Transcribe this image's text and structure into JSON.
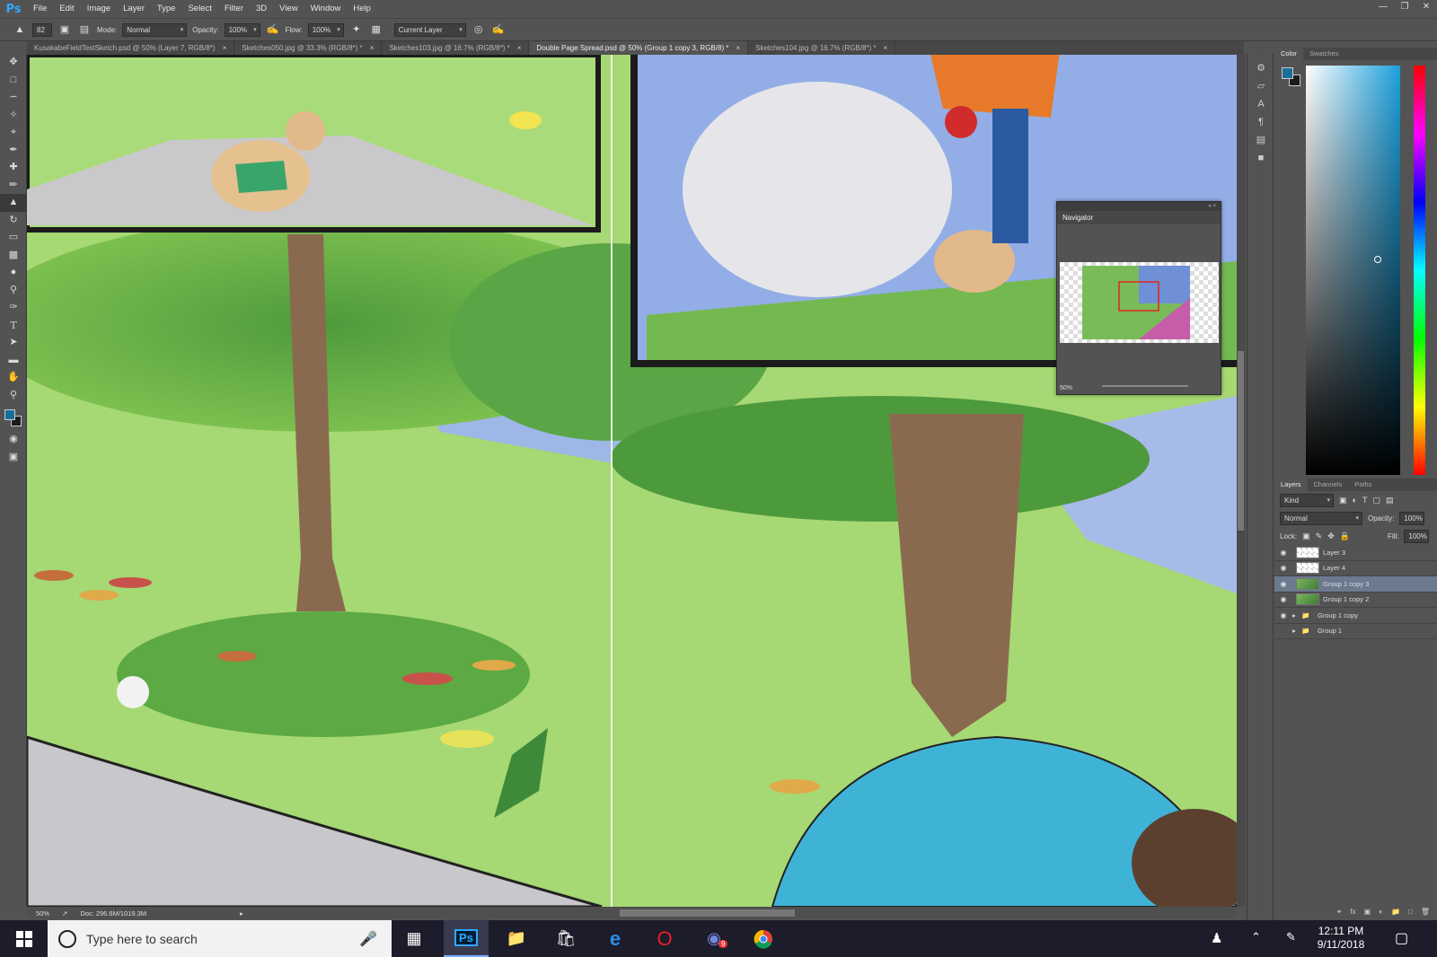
{
  "app": {
    "logo": "Ps"
  },
  "menu": [
    "File",
    "Edit",
    "Image",
    "Layer",
    "Type",
    "Select",
    "Filter",
    "3D",
    "View",
    "Window",
    "Help"
  ],
  "window_controls": [
    "minimize-icon",
    "restore-icon",
    "close-icon"
  ],
  "options": {
    "brush_size": "82",
    "mode_label": "Mode:",
    "mode": "Normal",
    "opacity_label": "Opacity:",
    "opacity": "100%",
    "flow_label": "Flow:",
    "flow": "100%",
    "sample": "Current Layer"
  },
  "tabs": [
    {
      "label": "KusakabeFieldTestSketch.psd @ 50% (Layer 7, RGB/8*)",
      "active": false
    },
    {
      "label": "Sketches050.jpg @ 33.3% (RGB/8*) *",
      "active": false
    },
    {
      "label": "Sketches103.jpg @ 16.7% (RGB/8*) *",
      "active": false
    },
    {
      "label": "Double Page Spread.psd @ 50% (Group 1 copy 3, RGB/8) *",
      "active": true
    },
    {
      "label": "Sketches104.jpg @ 16.7% (RGB/8*) *",
      "active": false
    }
  ],
  "tools": [
    "move-icon",
    "marquee-icon",
    "lasso-icon",
    "quick-select-icon",
    "crop-icon",
    "eyedropper-icon",
    "healing-icon",
    "brush-icon",
    "clone-stamp-icon",
    "history-brush-icon",
    "eraser-icon",
    "gradient-icon",
    "blur-icon",
    "dodge-icon",
    "pen-icon",
    "type-icon",
    "path-select-icon",
    "shape-icon",
    "hand-icon",
    "zoom-icon"
  ],
  "status": {
    "zoom": "50%",
    "doc": "Doc: 296.6M/1019.3M"
  },
  "navigator": {
    "title": "Navigator",
    "zoom": "50%"
  },
  "color_panel": {
    "tabs": [
      "Color",
      "Swatches"
    ],
    "foreground": "#1a6e9a",
    "background": "#1c1c1c"
  },
  "layers_panel": {
    "tabs": [
      "Layers",
      "Channels",
      "Paths"
    ],
    "kind": "Kind",
    "blend": "Normal",
    "opacity_label": "Opacity:",
    "opacity": "100%",
    "lock_label": "Lock:",
    "fill_label": "Fill:",
    "fill": "100%",
    "layers": [
      {
        "name": "Layer 3",
        "visible": true,
        "type": "layer",
        "selected": false
      },
      {
        "name": "Layer 4",
        "visible": true,
        "type": "layer",
        "selected": false
      },
      {
        "name": "Group 1 copy 3",
        "visible": true,
        "type": "image",
        "selected": true
      },
      {
        "name": "Group 1 copy 2",
        "visible": true,
        "type": "image",
        "selected": false
      },
      {
        "name": "Group 1 copy",
        "visible": true,
        "type": "group",
        "selected": false
      },
      {
        "name": "Group 1",
        "visible": false,
        "type": "group",
        "selected": false
      }
    ]
  },
  "taskbar": {
    "search_placeholder": "Type here to search",
    "time": "12:11 PM",
    "date": "9/11/2018",
    "apps": [
      "task-view-icon",
      "photoshop-icon",
      "file-explorer-icon",
      "store-icon",
      "edge-icon",
      "opera-icon",
      "discord-icon",
      "chrome-icon"
    ],
    "discord_badge": "9"
  }
}
